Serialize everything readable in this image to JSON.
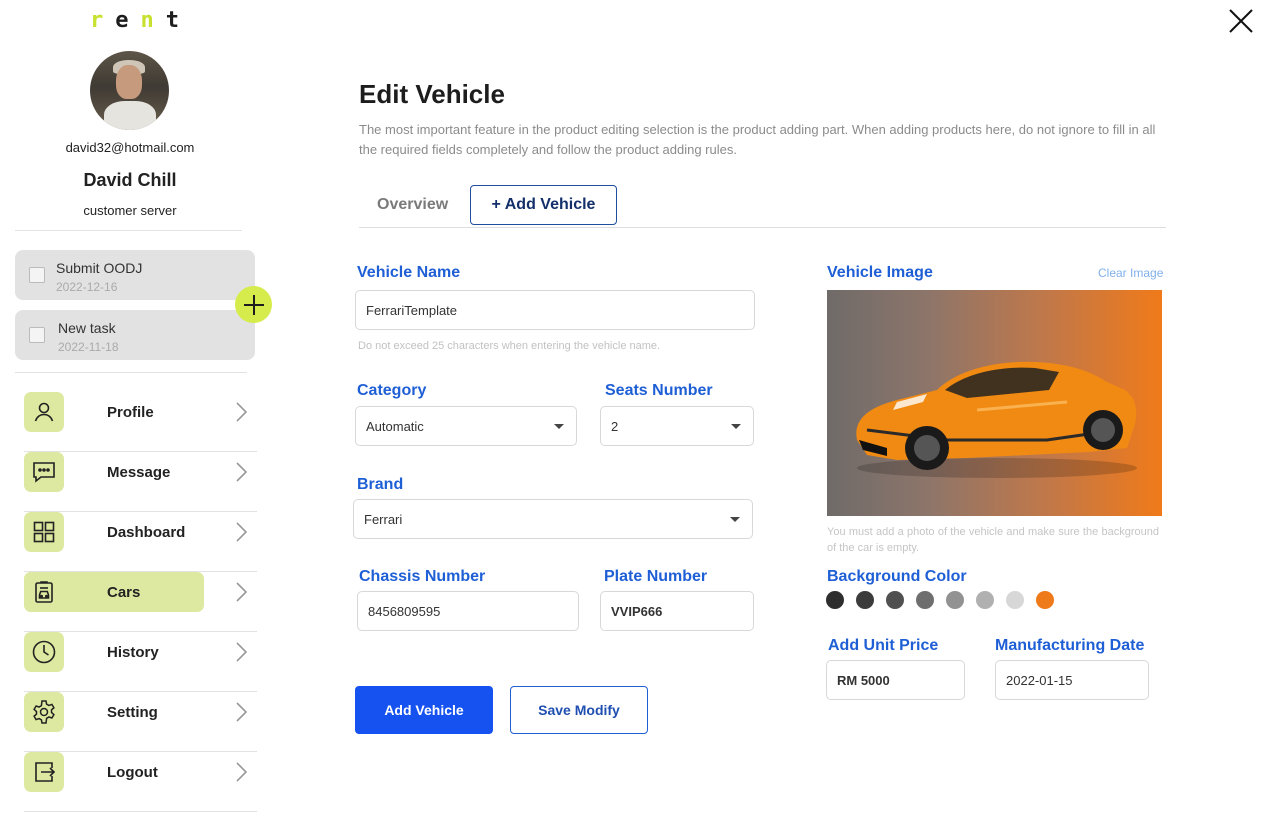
{
  "brand": {
    "logo_letters": [
      "r",
      "e",
      "n",
      "t"
    ],
    "logo_colors": [
      "#c8e02f",
      "#1d1d1d",
      "#c8e02f",
      "#1d1d1d"
    ]
  },
  "user": {
    "email": "david32@hotmail.com",
    "name": "David Chill",
    "role": "customer server"
  },
  "tasks": [
    {
      "title": "Submit OODJ",
      "date": "2022-12-16",
      "checked": false
    },
    {
      "title": "New task",
      "date": "2022-11-18",
      "checked": false
    }
  ],
  "nav": [
    {
      "label": "Profile",
      "icon": "user-icon",
      "active": false
    },
    {
      "label": "Message",
      "icon": "message-icon",
      "active": false
    },
    {
      "label": "Dashboard",
      "icon": "dashboard-icon",
      "active": false
    },
    {
      "label": "Cars",
      "icon": "car-icon",
      "active": true
    },
    {
      "label": "History",
      "icon": "clock-icon",
      "active": false
    },
    {
      "label": "Setting",
      "icon": "gear-icon",
      "active": false
    },
    {
      "label": "Logout",
      "icon": "logout-icon",
      "active": false
    }
  ],
  "page": {
    "title": "Edit Vehicle",
    "subtitle": "The most important feature in the product editing selection is the product adding part. When adding products here, do not ignore to fill in all the required fields completely and follow the product adding rules.",
    "tabs": {
      "overview": "Overview",
      "add_vehicle": "+ Add Vehicle"
    }
  },
  "form": {
    "vehicle_name": {
      "label": "Vehicle Name",
      "value": "FerrariTemplate",
      "hint": "Do not exceed 25 characters when entering the vehicle name."
    },
    "category": {
      "label": "Category",
      "value": "Automatic"
    },
    "seats": {
      "label": "Seats Number",
      "value": "2"
    },
    "brand": {
      "label": "Brand",
      "value": "Ferrari"
    },
    "chassis": {
      "label": "Chassis Number",
      "value": "8456809595"
    },
    "plate": {
      "label": "Plate Number",
      "value": "VVIP666"
    },
    "image": {
      "label": "Vehicle Image",
      "clear": "Clear Image",
      "hint": "You must add a photo of the vehicle and make sure the background of the car is empty."
    },
    "background_color": {
      "label": "Background Color",
      "swatches": [
        "#2e2e2e",
        "#3c3c3c",
        "#505050",
        "#6e6e6e",
        "#929292",
        "#b0b0b0",
        "#d7d7d7",
        "#ef7a1a"
      ]
    },
    "unit_price": {
      "label": "Add Unit Price",
      "value": "RM 5000"
    },
    "manufacturing_date": {
      "label": "Manufacturing Date",
      "value": "2022-01-15"
    }
  },
  "buttons": {
    "add": "Add Vehicle",
    "save": "Save Modify"
  },
  "colors": {
    "accent_green": "#d6ec4c",
    "nav_icon_bg": "#dde9a0",
    "primary_blue": "#1652f0",
    "label_blue": "#1f5fd6"
  }
}
